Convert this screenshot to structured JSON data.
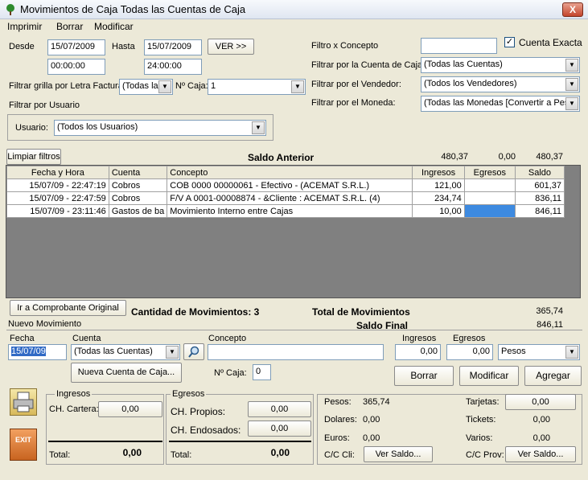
{
  "window": {
    "title": "Movimientos de Caja Todas las Cuentas de Caja",
    "close": "X"
  },
  "menu": [
    "Imprimir",
    "Borrar",
    "Modificar"
  ],
  "filters": {
    "desde_label": "Desde",
    "desde_date": "15/07/2009",
    "desde_time": "00:00:00",
    "hasta_label": "Hasta",
    "hasta_date": "15/07/2009",
    "hasta_time": "24:00:00",
    "ver_label": "VER >>",
    "letra_label": "Filtrar grilla por Letra Factura:",
    "letra_value": "(Todas las",
    "caja_label": "Nº Caja:",
    "caja_value": "1",
    "usuario_group": "Filtrar por Usuario",
    "usuario_label": "Usuario:",
    "usuario_value": "(Todos los Usuarios)",
    "concepto_label": "Filtro x Concepto",
    "concepto_value": "",
    "cuenta_exacta": "Cuenta Exacta",
    "cuenta_label": "Filtrar por la Cuenta de Caja:",
    "cuenta_value": "(Todas las Cuentas)",
    "vendedor_label": "Filtrar por el Vendedor:",
    "vendedor_value": "(Todos los Vendedores)",
    "moneda_label": "Filtrar por el Moneda:",
    "moneda_value": "(Todas las Monedas [Convertir a Pesos"
  },
  "limpiar": "Limpiar filtros",
  "saldo_anterior": {
    "label": "Saldo Anterior",
    "ingresos": "480,37",
    "egresos": "0,00",
    "saldo": "480,37"
  },
  "grid": {
    "headers": [
      "Fecha y Hora",
      "Cuenta",
      "Concepto",
      "Ingresos",
      "Egresos",
      "Saldo"
    ],
    "rows": [
      [
        "15/07/09 - 22:47:19",
        "Cobros",
        "COB  0000 00000061 - Efectivo - (ACEMAT S.R.L.)",
        "121,00",
        "",
        "601,37"
      ],
      [
        "15/07/09 - 22:47:59",
        "Cobros",
        "F/V A 0001-00008874 - &Cliente : ACEMAT S.R.L. (4)",
        "234,74",
        "",
        "836,11"
      ],
      [
        "15/07/09 - 23:11:46",
        "Gastos de ba",
        "Movimiento Interno entre Cajas",
        "10,00",
        "",
        "846,11"
      ]
    ]
  },
  "summary": {
    "ir_comprobante": "Ir a Comprobante Original",
    "cantidad": "Cantidad de Movimientos: 3",
    "total_label": "Total de Movimientos",
    "total_value": "365,74",
    "saldo_final_label": "Saldo Final",
    "saldo_final_value": "846,11"
  },
  "nuevo": {
    "title": "Nuevo Movimiento",
    "fecha_label": "Fecha",
    "fecha_value": "15/07/09",
    "cuenta_label": "Cuenta",
    "cuenta_value": "(Todas las Cuentas)",
    "concepto_label": "Concepto",
    "concepto_value": "",
    "ingresos_label": "Ingresos",
    "ingresos_value": "0,00",
    "egresos_label": "Egresos",
    "egresos_value": "0,00",
    "moneda_value": "Pesos",
    "nueva_cuenta": "Nueva Cuenta de Caja...",
    "caja_label": "Nº Caja:",
    "caja_value": "0",
    "borrar": "Borrar",
    "modificar": "Modificar",
    "agregar": "Agregar"
  },
  "totales": {
    "ingresos_title": "Ingresos",
    "ch_cartera_label": "CH. Cartera:",
    "ch_cartera_value": "0,00",
    "total_label": "Total:",
    "ingresos_total": "0,00",
    "egresos_title": "Egresos",
    "ch_propios_label": "CH. Propios:",
    "ch_propios_value": "0,00",
    "ch_endosados_label": "CH. Endosados:",
    "ch_endosados_value": "0,00",
    "egresos_total": "0,00",
    "pesos_label": "Pesos:",
    "pesos_value": "365,74",
    "dolares_label": "Dolares:",
    "dolares_value": "0,00",
    "euros_label": "Euros:",
    "euros_value": "0,00",
    "cc_cli_label": "C/C Cli:",
    "cc_cli_btn": "Ver Saldo...",
    "tarjetas_label": "Tarjetas:",
    "tarjetas_value": "0,00",
    "tickets_label": "Tickets:",
    "tickets_value": "0,00",
    "varios_label": "Varios:",
    "varios_value": "0,00",
    "cc_prov_label": "C/C Prov:",
    "cc_prov_btn": "Ver Saldo...",
    "exit_label": "EXIT"
  }
}
